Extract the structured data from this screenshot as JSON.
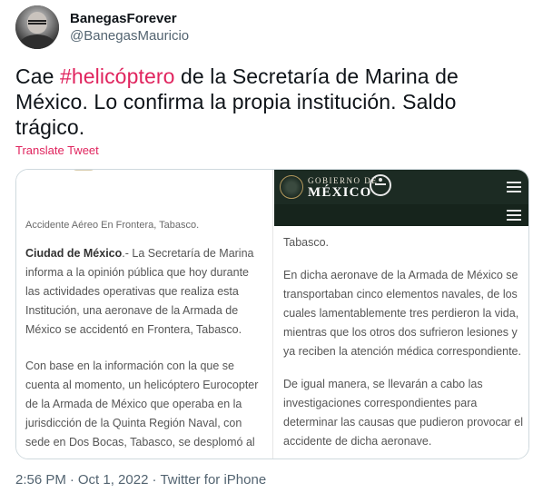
{
  "author": {
    "display_name": "BanegasForever",
    "handle": "@BanegasMauricio"
  },
  "tweet": {
    "text_before": "Cae ",
    "hashtag": "#helicóptero",
    "text_after": " de la Secretaría de Marina de México. Lo confirma la propia institución. Saldo trágico.",
    "translate_label": "Translate Tweet"
  },
  "media": {
    "left": {
      "caption": "Accidente Aéreo En Frontera, Tabasco.",
      "p1_strong": "Ciudad de México",
      "p1_rest": ".- La Secretaría de Marina informa a la opinión pública que hoy durante las actividades operativas que realiza esta Institución, una aeronave de la Armada de México se accidentó en Frontera, Tabasco.",
      "p2": "Con base en la información con la que se cuenta al momento, un helicóptero Eurocopter de la Armada de México que operaba en la jurisdicción de la Quinta Región Naval, con sede en Dos Bocas, Tabasco, se desplomó al"
    },
    "right": {
      "gov_top": "GOBIERNO DE",
      "gov_main": "MÉXICO",
      "p0": "Tabasco.",
      "p1": "En dicha aeronave de la Armada de México se transportaban cinco elementos navales, de los cuales lamentablemente tres perdieron la vida, mientras que los otros dos sufrieron lesiones y ya reciben la atención médica correspondiente.",
      "p2": "De igual manera, se llevarán a cabo las investigaciones correspondientes para determinar las causas que pudieron provocar el accidente de dicha aeronave."
    }
  },
  "meta": {
    "time": "2:56 PM",
    "separator": "·",
    "date": "Oct 1, 2022",
    "source": "Twitter for iPhone"
  },
  "colors": {
    "link": "#e0245e",
    "secondary_text": "#536471",
    "gov_bar": "#1c2b23"
  }
}
